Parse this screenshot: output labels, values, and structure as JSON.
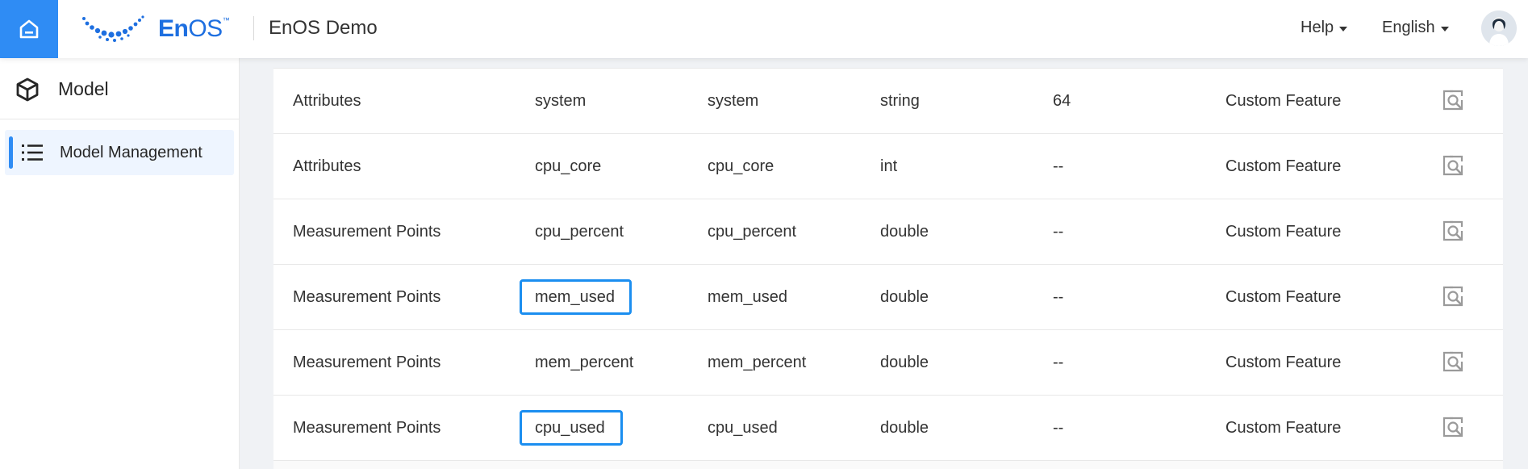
{
  "header": {
    "home_icon": "home-icon",
    "logo_text_bold": "En",
    "logo_text_light": "OS",
    "logo_tm": "™",
    "app_name": "EnOS Demo",
    "help_label": "Help",
    "language_label": "English",
    "accent_color": "#2f8cf4"
  },
  "sidebar": {
    "section_title": "Model",
    "section_icon": "cube-icon",
    "items": [
      {
        "label": "Model Management",
        "icon": "list-icon",
        "active": true
      }
    ]
  },
  "table": {
    "rows": [
      {
        "category": "Attributes",
        "identifier": "system",
        "name": "system",
        "data_type": "string",
        "length": "64",
        "feature_type": "Custom Feature",
        "highlighted": false
      },
      {
        "category": "Attributes",
        "identifier": "cpu_core",
        "name": "cpu_core",
        "data_type": "int",
        "length": "--",
        "feature_type": "Custom Feature",
        "highlighted": false
      },
      {
        "category": "Measurement Points",
        "identifier": "cpu_percent",
        "name": "cpu_percent",
        "data_type": "double",
        "length": "--",
        "feature_type": "Custom Feature",
        "highlighted": false
      },
      {
        "category": "Measurement Points",
        "identifier": "mem_used",
        "name": "mem_used",
        "data_type": "double",
        "length": "--",
        "feature_type": "Custom Feature",
        "highlighted": true
      },
      {
        "category": "Measurement Points",
        "identifier": "mem_percent",
        "name": "mem_percent",
        "data_type": "double",
        "length": "--",
        "feature_type": "Custom Feature",
        "highlighted": false
      },
      {
        "category": "Measurement Points",
        "identifier": "cpu_used",
        "name": "cpu_used",
        "data_type": "double",
        "length": "--",
        "feature_type": "Custom Feature",
        "highlighted": true
      }
    ],
    "action_icon": "view-details-icon",
    "highlight_color": "#1b8ef0"
  }
}
